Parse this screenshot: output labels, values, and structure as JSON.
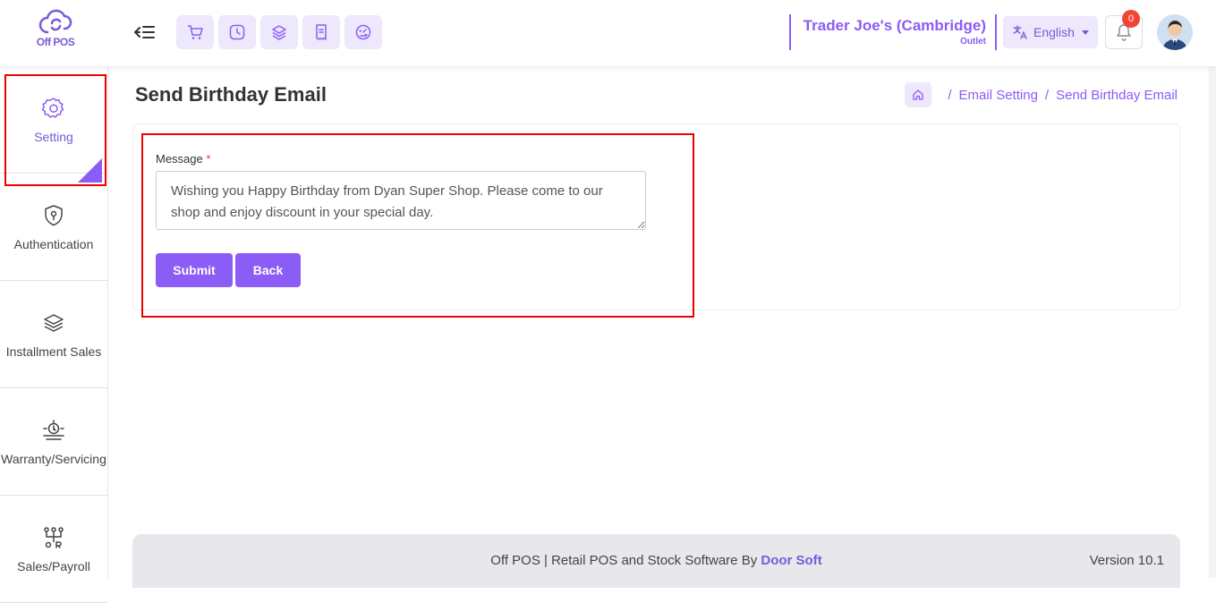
{
  "app": {
    "logo_text": "Off POS"
  },
  "header": {
    "outlet_name": "Trader Joe's (Cambridge)",
    "outlet_sub": "Outlet",
    "language": "English",
    "notification_count": "0",
    "quick_buttons": [
      "cart-icon",
      "clock-icon",
      "layers-icon",
      "receipt-icon",
      "dashboard-icon"
    ]
  },
  "sidebar": {
    "items": [
      {
        "label": "Setting",
        "icon": "gear-icon"
      },
      {
        "label": "Authentication",
        "icon": "shield-icon"
      },
      {
        "label": "Installment Sales",
        "icon": "layers-icon"
      },
      {
        "label": "Warranty/Servicing",
        "icon": "warranty-icon"
      },
      {
        "label": "Sales/Payroll",
        "icon": "flow-icon"
      }
    ]
  },
  "page": {
    "title": "Send Birthday Email",
    "breadcrumb": {
      "parent": "Email Setting",
      "current": "Send Birthday Email"
    }
  },
  "form": {
    "message_label": "Message",
    "required_mark": "*",
    "message_value": "Wishing you Happy Birthday from Dyan Super Shop. Please come to our shop and enjoy discount in your special day.",
    "submit_label": "Submit",
    "back_label": "Back"
  },
  "footer": {
    "text_prefix": "Off POS | Retail POS and Stock Software By ",
    "brand": "Door Soft",
    "version": "Version 10.1"
  },
  "colors": {
    "accent": "#8b5cf6",
    "accent_light": "#ede8fc",
    "highlight": "#ee0000"
  }
}
